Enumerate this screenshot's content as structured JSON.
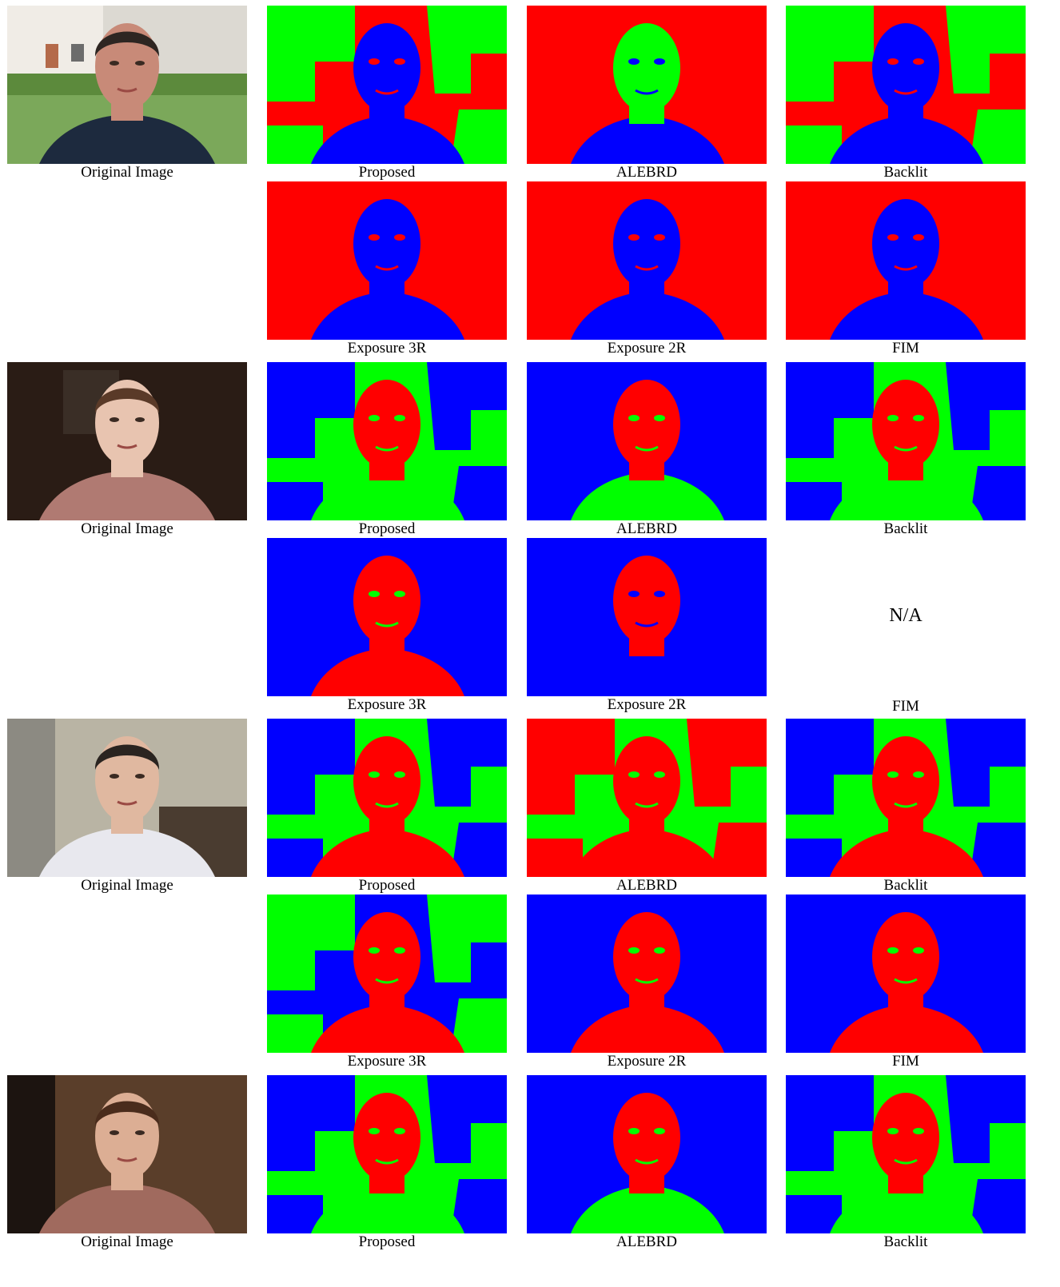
{
  "colors": {
    "red": "#ff0000",
    "green": "#00ff00",
    "blue": "#0000ff"
  },
  "rows": [
    {
      "original": {
        "caption": "Original Image",
        "scene": "man-outdoor"
      },
      "panels": [
        {
          "caption": "Proposed",
          "bg": "red-green",
          "head": "blue",
          "body": "blue"
        },
        {
          "caption": "ALEBRD",
          "bg": "red",
          "head": "green",
          "body": "blue"
        },
        {
          "caption": "Backlit",
          "bg": "red-green",
          "head": "blue",
          "body": "blue"
        }
      ]
    },
    {
      "original": null,
      "panels": [
        {
          "caption": "Exposure 3R",
          "bg": "red",
          "head": "blue",
          "body": "blue"
        },
        {
          "caption": "Exposure 2R",
          "bg": "red",
          "head": "blue",
          "body": "blue"
        },
        {
          "caption": "FIM",
          "bg": "red",
          "head": "blue",
          "body": "blue"
        }
      ]
    },
    {
      "original": {
        "caption": "Original Image",
        "scene": "woman-indoor"
      },
      "panels": [
        {
          "caption": "Proposed",
          "bg": "green-blue",
          "head": "red",
          "body": "green"
        },
        {
          "caption": "ALEBRD",
          "bg": "blue",
          "head": "red",
          "body": "green"
        },
        {
          "caption": "Backlit",
          "bg": "green-blue",
          "head": "red",
          "body": "green"
        }
      ]
    },
    {
      "original": null,
      "panels": [
        {
          "caption": "Exposure 3R",
          "bg": "blue",
          "head": "red",
          "body": "red"
        },
        {
          "caption": "Exposure 2R",
          "bg": "blue",
          "head": "red",
          "body": "blue"
        },
        {
          "caption": "FIM",
          "na": "N/A"
        }
      ]
    },
    {
      "original": {
        "caption": "Original Image",
        "scene": "man-lab"
      },
      "panels": [
        {
          "caption": "Proposed",
          "bg": "green-blue",
          "head": "red",
          "body": "red"
        },
        {
          "caption": "ALEBRD",
          "bg": "green-red",
          "head": "red",
          "body": "red"
        },
        {
          "caption": "Backlit",
          "bg": "green-blue",
          "head": "red",
          "body": "red"
        }
      ]
    },
    {
      "original": null,
      "panels": [
        {
          "caption": "Exposure 3R",
          "bg": "blue-green",
          "head": "red",
          "body": "red"
        },
        {
          "caption": "Exposure 2R",
          "bg": "blue",
          "head": "red",
          "body": "red"
        },
        {
          "caption": "FIM",
          "bg": "blue",
          "head": "red",
          "body": "red"
        }
      ]
    },
    {
      "original": {
        "caption": "Original Image",
        "scene": "woman-dark"
      },
      "panels": [
        {
          "caption": "Proposed",
          "bg": "green-blue",
          "head": "red",
          "body": "green"
        },
        {
          "caption": "ALEBRD",
          "bg": "blue",
          "head": "red",
          "body": "green"
        },
        {
          "caption": "Backlit",
          "bg": "green-blue",
          "head": "red",
          "body": "green"
        }
      ]
    }
  ]
}
